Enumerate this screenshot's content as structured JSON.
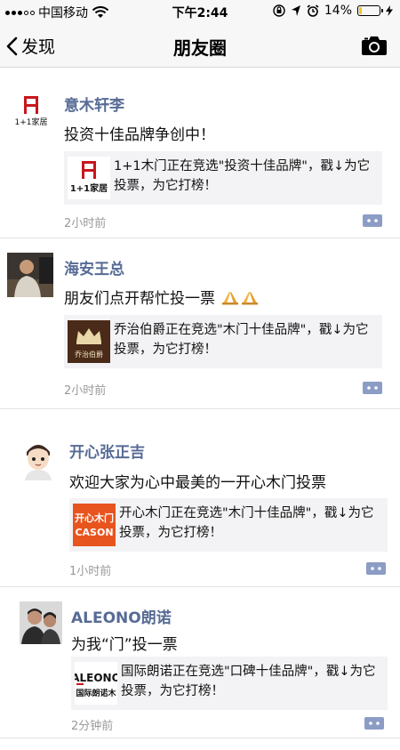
{
  "status_bar": {
    "carrier": "中国移动",
    "time": "下午2:44",
    "battery_percent": "14%",
    "battery_level": 0.14,
    "battery_color": "#f3c42b"
  },
  "nav": {
    "back_label": "发现",
    "title": "朋友圈",
    "camera_icon": "camera-icon"
  },
  "accent": {
    "author_color": "#576b95",
    "card_bg": "#f3f3f5"
  },
  "posts": [
    {
      "author": "意木轩李",
      "text": "投资十佳品牌争创中！",
      "link_text": "1+1木门正在竞选\"投资十佳品牌\"，戳↓为它投票，为它打榜！",
      "thumb_text": "1+1家居",
      "avatar_text": "1+1家居",
      "time": "2小时前"
    },
    {
      "author": "海安王总",
      "text": "朋友们点开帮忙投一票",
      "emoji": "praying-hands-icon",
      "link_text": "乔治伯爵正在竞选\"木门十佳品牌\"，戳↓为它投票，为它打榜！",
      "thumb_text": "乔治伯爵",
      "time": "2小时前"
    },
    {
      "author": "开心张正吉",
      "text": "欢迎大家为心中最美的一开心木门投票",
      "link_text": "开心木门正在竞选\"木门十佳品牌\"，戳↓为它投票，为它打榜！",
      "thumb_text": "开心木门",
      "thumb_sub": "CASON",
      "time": "1小时前"
    },
    {
      "author": "ALEONO朗诺",
      "text": "为我“门”投一票",
      "link_text": "国际朗诺正在竞选\"口碑十佳品牌\"，戳↓为它投票，为它打榜！",
      "thumb_text": "ALEONO",
      "thumb_sub": "国际朗诺木",
      "time": "2分钟前"
    }
  ]
}
